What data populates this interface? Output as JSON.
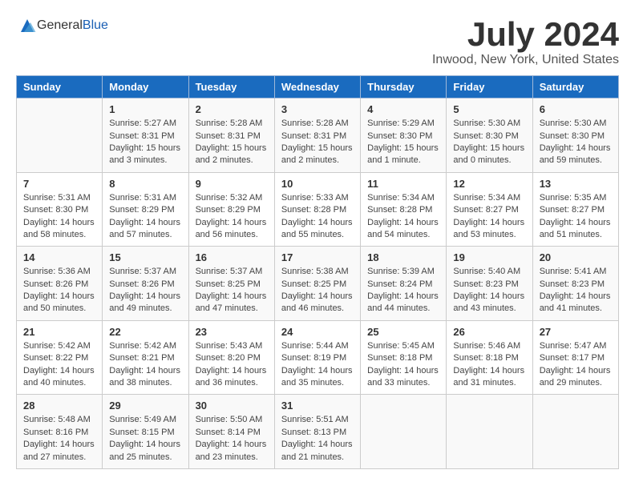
{
  "header": {
    "logo": {
      "text_general": "General",
      "text_blue": "Blue"
    },
    "title": "July 2024",
    "location": "Inwood, New York, United States"
  },
  "days_of_week": [
    "Sunday",
    "Monday",
    "Tuesday",
    "Wednesday",
    "Thursday",
    "Friday",
    "Saturday"
  ],
  "weeks": [
    [
      {
        "day": "",
        "content": ""
      },
      {
        "day": "1",
        "content": "Sunrise: 5:27 AM\nSunset: 8:31 PM\nDaylight: 15 hours\nand 3 minutes."
      },
      {
        "day": "2",
        "content": "Sunrise: 5:28 AM\nSunset: 8:31 PM\nDaylight: 15 hours\nand 2 minutes."
      },
      {
        "day": "3",
        "content": "Sunrise: 5:28 AM\nSunset: 8:31 PM\nDaylight: 15 hours\nand 2 minutes."
      },
      {
        "day": "4",
        "content": "Sunrise: 5:29 AM\nSunset: 8:30 PM\nDaylight: 15 hours\nand 1 minute."
      },
      {
        "day": "5",
        "content": "Sunrise: 5:30 AM\nSunset: 8:30 PM\nDaylight: 15 hours\nand 0 minutes."
      },
      {
        "day": "6",
        "content": "Sunrise: 5:30 AM\nSunset: 8:30 PM\nDaylight: 14 hours\nand 59 minutes."
      }
    ],
    [
      {
        "day": "7",
        "content": "Sunrise: 5:31 AM\nSunset: 8:30 PM\nDaylight: 14 hours\nand 58 minutes."
      },
      {
        "day": "8",
        "content": "Sunrise: 5:31 AM\nSunset: 8:29 PM\nDaylight: 14 hours\nand 57 minutes."
      },
      {
        "day": "9",
        "content": "Sunrise: 5:32 AM\nSunset: 8:29 PM\nDaylight: 14 hours\nand 56 minutes."
      },
      {
        "day": "10",
        "content": "Sunrise: 5:33 AM\nSunset: 8:28 PM\nDaylight: 14 hours\nand 55 minutes."
      },
      {
        "day": "11",
        "content": "Sunrise: 5:34 AM\nSunset: 8:28 PM\nDaylight: 14 hours\nand 54 minutes."
      },
      {
        "day": "12",
        "content": "Sunrise: 5:34 AM\nSunset: 8:27 PM\nDaylight: 14 hours\nand 53 minutes."
      },
      {
        "day": "13",
        "content": "Sunrise: 5:35 AM\nSunset: 8:27 PM\nDaylight: 14 hours\nand 51 minutes."
      }
    ],
    [
      {
        "day": "14",
        "content": "Sunrise: 5:36 AM\nSunset: 8:26 PM\nDaylight: 14 hours\nand 50 minutes."
      },
      {
        "day": "15",
        "content": "Sunrise: 5:37 AM\nSunset: 8:26 PM\nDaylight: 14 hours\nand 49 minutes."
      },
      {
        "day": "16",
        "content": "Sunrise: 5:37 AM\nSunset: 8:25 PM\nDaylight: 14 hours\nand 47 minutes."
      },
      {
        "day": "17",
        "content": "Sunrise: 5:38 AM\nSunset: 8:25 PM\nDaylight: 14 hours\nand 46 minutes."
      },
      {
        "day": "18",
        "content": "Sunrise: 5:39 AM\nSunset: 8:24 PM\nDaylight: 14 hours\nand 44 minutes."
      },
      {
        "day": "19",
        "content": "Sunrise: 5:40 AM\nSunset: 8:23 PM\nDaylight: 14 hours\nand 43 minutes."
      },
      {
        "day": "20",
        "content": "Sunrise: 5:41 AM\nSunset: 8:23 PM\nDaylight: 14 hours\nand 41 minutes."
      }
    ],
    [
      {
        "day": "21",
        "content": "Sunrise: 5:42 AM\nSunset: 8:22 PM\nDaylight: 14 hours\nand 40 minutes."
      },
      {
        "day": "22",
        "content": "Sunrise: 5:42 AM\nSunset: 8:21 PM\nDaylight: 14 hours\nand 38 minutes."
      },
      {
        "day": "23",
        "content": "Sunrise: 5:43 AM\nSunset: 8:20 PM\nDaylight: 14 hours\nand 36 minutes."
      },
      {
        "day": "24",
        "content": "Sunrise: 5:44 AM\nSunset: 8:19 PM\nDaylight: 14 hours\nand 35 minutes."
      },
      {
        "day": "25",
        "content": "Sunrise: 5:45 AM\nSunset: 8:18 PM\nDaylight: 14 hours\nand 33 minutes."
      },
      {
        "day": "26",
        "content": "Sunrise: 5:46 AM\nSunset: 8:18 PM\nDaylight: 14 hours\nand 31 minutes."
      },
      {
        "day": "27",
        "content": "Sunrise: 5:47 AM\nSunset: 8:17 PM\nDaylight: 14 hours\nand 29 minutes."
      }
    ],
    [
      {
        "day": "28",
        "content": "Sunrise: 5:48 AM\nSunset: 8:16 PM\nDaylight: 14 hours\nand 27 minutes."
      },
      {
        "day": "29",
        "content": "Sunrise: 5:49 AM\nSunset: 8:15 PM\nDaylight: 14 hours\nand 25 minutes."
      },
      {
        "day": "30",
        "content": "Sunrise: 5:50 AM\nSunset: 8:14 PM\nDaylight: 14 hours\nand 23 minutes."
      },
      {
        "day": "31",
        "content": "Sunrise: 5:51 AM\nSunset: 8:13 PM\nDaylight: 14 hours\nand 21 minutes."
      },
      {
        "day": "",
        "content": ""
      },
      {
        "day": "",
        "content": ""
      },
      {
        "day": "",
        "content": ""
      }
    ]
  ]
}
